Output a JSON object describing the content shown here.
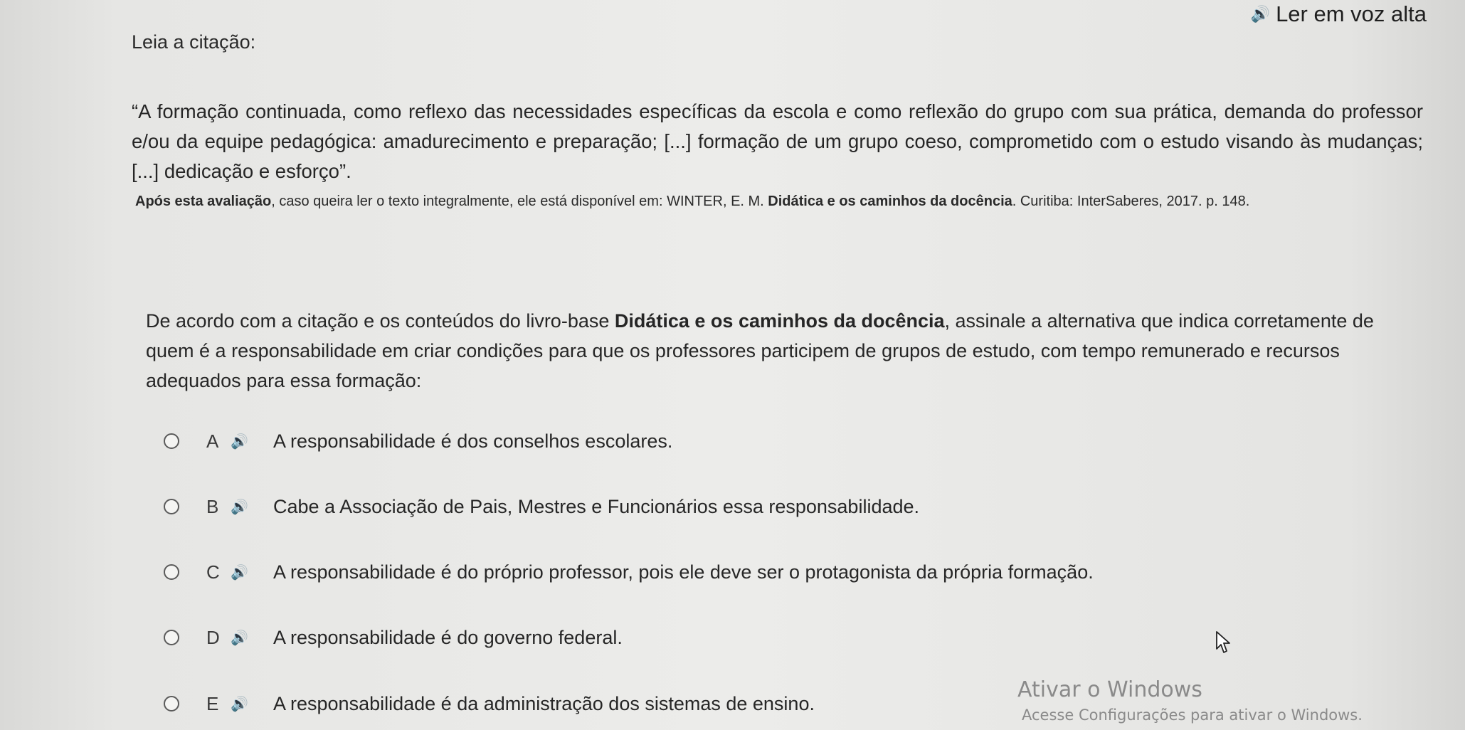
{
  "header": {
    "read_aloud_label": "Ler em voz alta",
    "speaker_icon": "speaker-icon"
  },
  "intro": "Leia a citação:",
  "quote": "“A formação continuada, como reflexo das necessidades específicas da escola e como reflexão do grupo com sua prática, demanda do professor e/ou da equipe pedagógica: amadurecimento e preparação; [...] formação de um grupo coeso, comprometido com o estudo visando às mudanças; [...] dedicação e esforço”.",
  "source": {
    "lead_bold": "Após esta avaliação",
    "middle": ", caso queira ler o texto integralmente, ele está disponível em: WINTER, E. M. ",
    "book_bold": "Didática e os caminhos da docência",
    "tail": ". Curitiba: InterSaberes, 2017. p. 148."
  },
  "question": {
    "part1": "De acordo com a citação e os conteúdos do livro-base ",
    "book_bold": "Didática e os caminhos da docência",
    "part2": ", assinale a alternativa que indica corretamente de quem é a responsabilidade em criar condições para que os professores participem de grupos de estudo, com tempo remunerado e recursos adequados para essa formação:"
  },
  "options": [
    {
      "letter": "A",
      "text": "A responsabilidade é dos conselhos escolares."
    },
    {
      "letter": "B",
      "text": "Cabe a Associação de Pais, Mestres e Funcionários essa responsabilidade."
    },
    {
      "letter": "C",
      "text": "A responsabilidade é do próprio professor, pois ele deve ser o protagonista da própria formação."
    },
    {
      "letter": "D",
      "text": "A responsabilidade é do governo federal."
    },
    {
      "letter": "E",
      "text": "A responsabilidade é da administração dos sistemas de ensino."
    }
  ],
  "watermark": {
    "title": "Ativar o Windows",
    "subtitle": "Acesse Configurações para ativar o Windows."
  }
}
